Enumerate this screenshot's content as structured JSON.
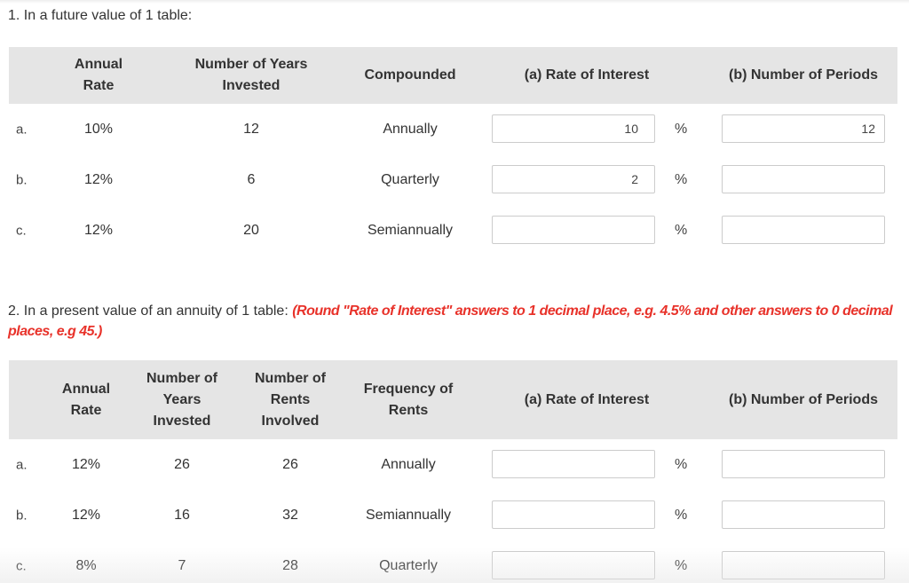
{
  "q1": {
    "title": "1. In a future value of 1 table:",
    "headers": {
      "annual_rate": [
        "Annual",
        "Rate"
      ],
      "years": [
        "Number of Years",
        "Invested"
      ],
      "compounded": [
        "Compounded"
      ],
      "rate_of_interest": [
        "(a) Rate of Interest"
      ],
      "num_periods": [
        "(b) Number of Periods"
      ]
    },
    "rows": [
      {
        "label": "a.",
        "annual_rate": "10%",
        "years": "12",
        "compounded": "Annually",
        "rate_value": "10",
        "rate_unit": "%",
        "periods_value": "12"
      },
      {
        "label": "b.",
        "annual_rate": "12%",
        "years": "6",
        "compounded": "Quarterly",
        "rate_value": "2",
        "rate_unit": "%",
        "periods_value": ""
      },
      {
        "label": "c.",
        "annual_rate": "12%",
        "years": "20",
        "compounded": "Semiannually",
        "rate_value": "",
        "rate_unit": "%",
        "periods_value": ""
      }
    ]
  },
  "q2": {
    "title": "2. In a present value of an annuity of 1 table: ",
    "instruction": "(Round \"Rate of Interest\" answers to 1 decimal place, e.g. 4.5% and other answers to 0 decimal places, e.g 45.)",
    "headers": {
      "annual_rate": [
        "Annual",
        "Rate"
      ],
      "years": [
        "Number of",
        "Years",
        "Invested"
      ],
      "rents": [
        "Number of",
        "Rents",
        "Involved"
      ],
      "frequency": [
        "Frequency of",
        "Rents"
      ],
      "rate_of_interest": [
        "(a) Rate of Interest"
      ],
      "num_periods": [
        "(b) Number of Periods"
      ]
    },
    "rows": [
      {
        "label": "a.",
        "annual_rate": "12%",
        "years": "26",
        "rents": "26",
        "frequency": "Annually",
        "rate_value": "",
        "rate_unit": "%",
        "periods_value": ""
      },
      {
        "label": "b.",
        "annual_rate": "12%",
        "years": "16",
        "rents": "32",
        "frequency": "Semiannually",
        "rate_value": "",
        "rate_unit": "%",
        "periods_value": ""
      },
      {
        "label": "c.",
        "annual_rate": "8%",
        "years": "7",
        "rents": "28",
        "frequency": "Quarterly",
        "rate_value": "",
        "rate_unit": "%",
        "periods_value": ""
      }
    ]
  },
  "colors": {
    "instruction": "#e8322a",
    "header_bg": "#e5e5e5"
  }
}
